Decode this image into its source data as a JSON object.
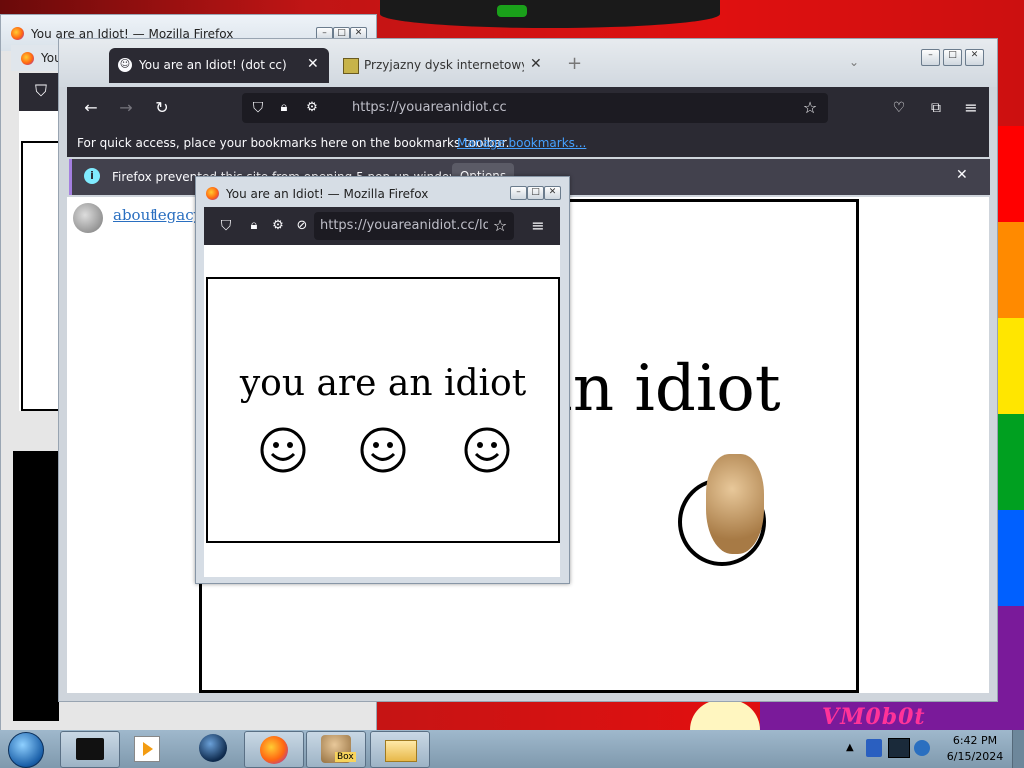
{
  "desktop": {
    "overlay_text": "VM0b0t",
    "rainbow": [
      "#ff0000",
      "#ff8a00",
      "#ffe600",
      "#00a020",
      "#0060ff",
      "#7a1a9a"
    ]
  },
  "back_window": {
    "title": "You are an Idiot! — Mozilla Firefox",
    "tab_label": "You"
  },
  "main_window": {
    "tabs": [
      {
        "label": "You are an Idiot! (dot cc)",
        "active": true
      },
      {
        "label": "Przyjazny dysk internetowy - Ch",
        "active": false
      }
    ],
    "new_tab": "+",
    "url": "https://youareanidiot.cc",
    "bookmarks_hint": "For quick access, place your bookmarks here on the bookmarks toolbar.",
    "bookmarks_link": "Manage bookmarks...",
    "infobar_text": "Firefox prevented this site from opening 5 pop-up windows.",
    "infobar_button": "Options",
    "page_links": [
      "about",
      "legacy"
    ],
    "page_big_text": "you are an idiot"
  },
  "popup_window": {
    "title": "You are an Idiot! — Mozilla Firefox",
    "url": "https://youareanidiot.cc/lol.",
    "text": "you are an idiot"
  },
  "taskbar": {
    "time": "6:42 PM",
    "date": "6/15/2024",
    "box_label": "Box"
  },
  "colors": {
    "firefox_dark": "#2b2a33",
    "link": "#45a1ff",
    "taskbar": "#8ea7bb"
  }
}
